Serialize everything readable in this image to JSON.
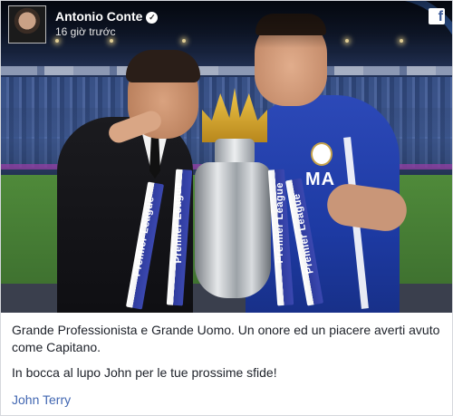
{
  "post": {
    "author_name": "Antonio Conte",
    "verified_icon": "verified-check-icon",
    "timestamp": "16 giờ trước",
    "platform_icon": "facebook-icon",
    "platform_glyph": "f",
    "caption_line1": "Grande Professionista e Grande Uomo. Un onore ed un piacere averti avuto come Capitano.",
    "caption_line2": "In bocca al lupo John per le tue prossime sfide!",
    "tagged_person": "John Terry"
  },
  "photo": {
    "ribbon_text": "Premier League",
    "sponsor_text": "MA"
  },
  "colors": {
    "link": "#4267b2",
    "text": "#1d2129",
    "chelsea_blue": "#1d3aa3"
  }
}
